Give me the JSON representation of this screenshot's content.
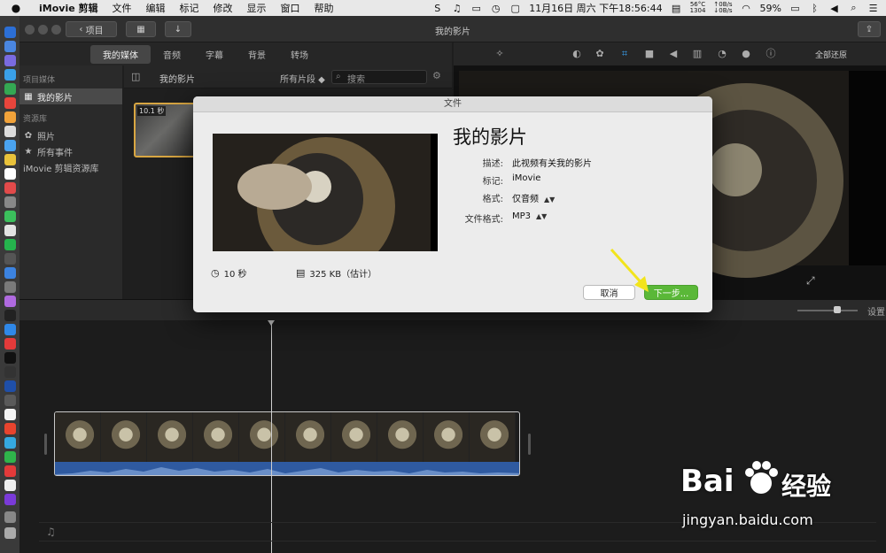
{
  "menubar": {
    "app_name": "iMovie 剪辑",
    "items": [
      "文件",
      "编辑",
      "标记",
      "修改",
      "显示",
      "窗口",
      "帮助"
    ],
    "cpu_temp": "56°C",
    "cpu_fan": "1304",
    "net_up": "↑0B/s",
    "net_down": "↓0B/s",
    "datetime": "11月16日 周六 下午18:56:44",
    "battery": "59%"
  },
  "toolbar": {
    "back_label": "项目",
    "window_title": "我的影片"
  },
  "tabs": [
    "我的媒体",
    "音频",
    "字幕",
    "背景",
    "转场"
  ],
  "tools": {
    "reset_all": "全部还原"
  },
  "sidebar": {
    "project_media_header": "项目媒体",
    "my_movie": "我的影片",
    "library_header": "资源库",
    "photos": "照片",
    "all_events": "所有事件",
    "library": "iMovie 剪辑资源库"
  },
  "browser": {
    "title": "我的影片",
    "filter": "所有片段 ◆",
    "search_placeholder": "搜索",
    "clip_duration": "10.1 秒"
  },
  "timeline": {
    "settings": "设置"
  },
  "dialog": {
    "window_title": "文件",
    "title": "我的影片",
    "desc_label": "描述:",
    "desc_value": "此视频有关我的影片",
    "tags_label": "标记:",
    "tags_value": "iMovie",
    "format_label": "格式:",
    "format_value": "仅音频",
    "file_format_label": "文件格式:",
    "file_format_value": "MP3",
    "duration": "10 秒",
    "size": "325 KB（估计）",
    "cancel": "取消",
    "next": "下一步..."
  },
  "watermark": {
    "brand": "Bai",
    "brand_suffix": "经验",
    "url": "jingyan.baidu.com"
  },
  "colors": {
    "accent_green": "#5ab838",
    "clip_border": "#d8a642",
    "audio_wave": "#2f5aa0",
    "arrow": "#f2e41c"
  }
}
